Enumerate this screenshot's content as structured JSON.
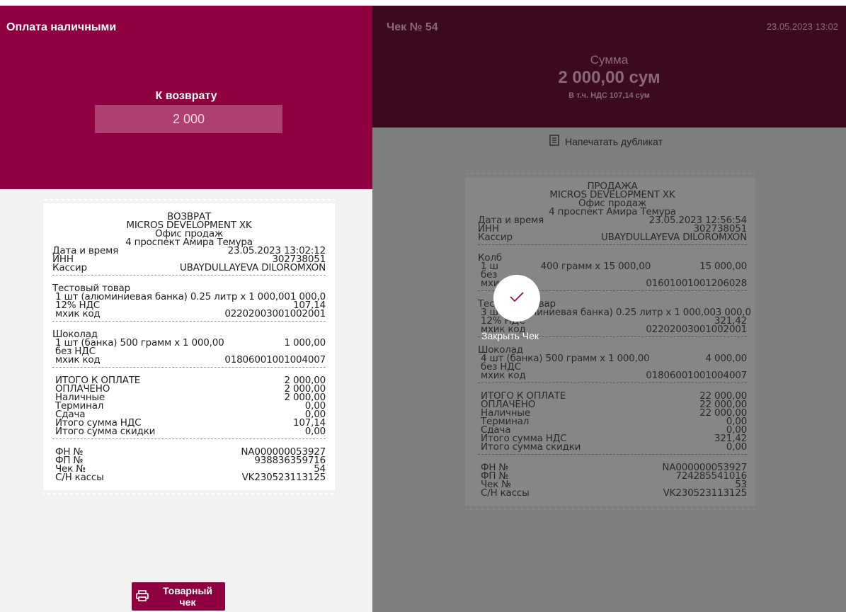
{
  "left": {
    "title": "Оплата наличными",
    "refund_label": "К возврату",
    "refund_value": "2 000",
    "print_button": "Товарный чек"
  },
  "right": {
    "check_number": "Чек № 54",
    "datetime": "23.05.2023 13:02",
    "sum_label": "Сумма",
    "sum_value": "2 000,00 сум",
    "vat_text": "В т.ч. НДС 107,14 сум",
    "duplicate_button": "Напечатать дубликат",
    "close_label": "Закрыть Чек"
  },
  "receipt_refund": {
    "header": [
      "ВОЗВРАТ",
      "MICROS DEVELOPMENT XK",
      "Офис продаж",
      "4 проспект Амира Темура"
    ],
    "info": [
      [
        "Дата и время",
        "23.05.2023 13:02:12"
      ],
      [
        "ИНН",
        "302738051"
      ],
      [
        "Кассир",
        "UBAYDULLAYEVA DILOROMXON"
      ]
    ],
    "items": [
      {
        "name": "Тестовый товар",
        "qty": "1 шт (алюминиевая банка) 0.25 литр x 1 000,00",
        "amount": "1 000,0",
        "vat": "12% НДС",
        "vat_amount": "107,14",
        "code_label": "мхик код",
        "code": "02202003001002001"
      },
      {
        "name": "Шоколад",
        "qty": "1 шт (банка) 500 грамм x 1 000,00",
        "amount": "1 000,00",
        "vat": "без НДС",
        "vat_amount": "",
        "code_label": "мхик код",
        "code": "01806001001004007"
      }
    ],
    "totals": [
      [
        "ИТОГО К ОПЛАТЕ",
        "2 000,00"
      ],
      [
        "ОПЛАЧЕНО",
        "2 000,00"
      ],
      [
        "Наличные",
        "2 000,00"
      ],
      [
        "Терминал",
        "0,00"
      ],
      [
        "Сдача",
        "0,00"
      ],
      [
        "Итого сумма НДС",
        "107,14"
      ],
      [
        "Итого сумма скидки",
        "0,00"
      ]
    ],
    "fiscal": [
      [
        "ФН №",
        "NA000000053927"
      ],
      [
        "ФП №",
        "938836359716"
      ],
      [
        "Чек №",
        "54"
      ],
      [
        "С/Н кассы",
        "VK230523113125"
      ]
    ]
  },
  "receipt_sale": {
    "header": [
      "ПРОДАЖА",
      "MICROS DEVELOPMENT XK",
      "Офис продаж",
      "4 проспект Амира Темура"
    ],
    "info": [
      [
        "Дата и время",
        "23.05.2023 12:56:54"
      ],
      [
        "ИНН",
        "302738051"
      ],
      [
        "Кассир",
        "UBAYDULLAYEVA DILOROMXON"
      ]
    ],
    "items": [
      {
        "name": "Колб",
        "qty": "1 ш",
        "qty_tail": "400 грамм x 15 000,00",
        "amount": "15 000,00",
        "vat": "без",
        "vat_amount": "",
        "code_label": "мхи",
        "code": "01601001001206028"
      },
      {
        "name": "Тестовый товар",
        "qty": "3 шт (алюминиевая банка) 0.25 литр x 1 000,00",
        "amount": "3 000,0",
        "vat": "12% НДС",
        "vat_amount": "321,42",
        "code_label": "мхик код",
        "code": "02202003001002001"
      },
      {
        "name": "Шоколад",
        "qty": "4 шт (банка) 500 грамм x 1 000,00",
        "amount": "4 000,00",
        "vat": "без НДС",
        "vat_amount": "",
        "code_label": "мхик код",
        "code": "01806001001004007"
      }
    ],
    "totals": [
      [
        "ИТОГО К ОПЛАТЕ",
        "22 000,00"
      ],
      [
        "ОПЛАЧЕНО",
        "22 000,00"
      ],
      [
        "Наличные",
        "22 000,00"
      ],
      [
        "Терминал",
        "0,00"
      ],
      [
        "Сдача",
        "0,00"
      ],
      [
        "Итого сумма НДС",
        "321,42"
      ],
      [
        "Итого сумма скидки",
        "0,00"
      ]
    ],
    "fiscal": [
      [
        "ФН №",
        "NA000000053927"
      ],
      [
        "ФП №",
        "724285541016"
      ],
      [
        "Чек №",
        "53"
      ],
      [
        "С/Н кассы",
        "VK230523113125"
      ]
    ]
  },
  "colors": {
    "primary": "#8f0040",
    "dark_header": "#3c0a1e",
    "overlay": "#7e7e7e"
  }
}
